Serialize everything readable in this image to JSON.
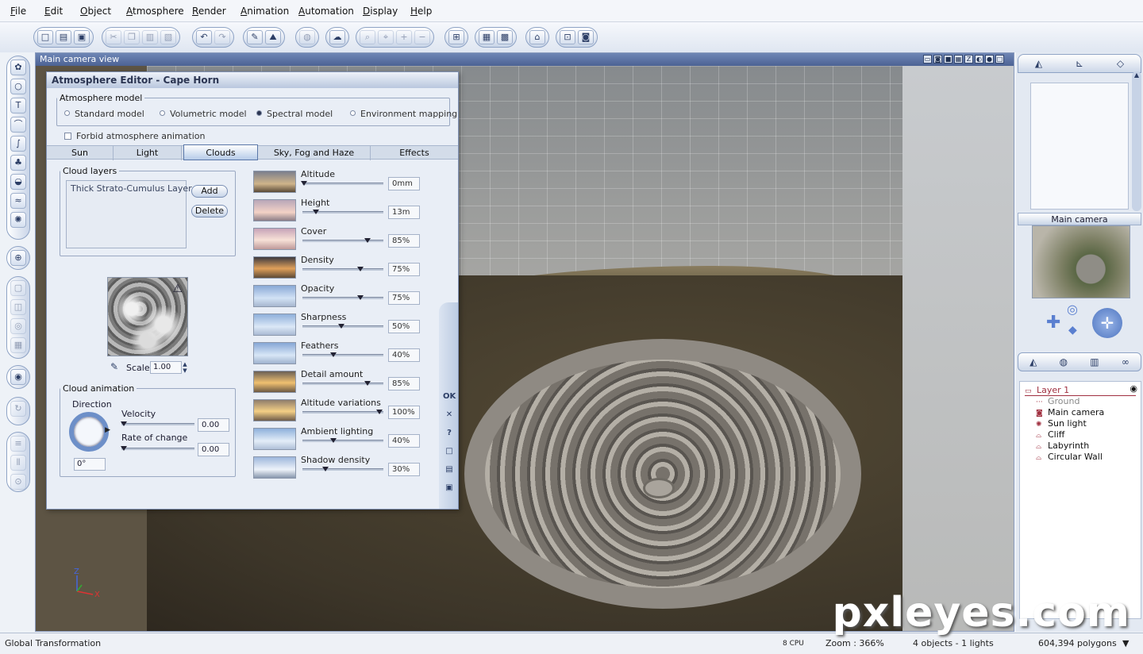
{
  "menu": [
    "File",
    "Edit",
    "Object",
    "Atmosphere",
    "Render",
    "Animation",
    "Automation",
    "Display",
    "Help"
  ],
  "viewport": {
    "title": "Main camera view"
  },
  "editor": {
    "title": "Atmosphere Editor - Cape Horn",
    "model_legend": "Atmosphere model",
    "models": [
      "Standard model",
      "Volumetric model",
      "Spectral model",
      "Environment mapping"
    ],
    "selected_model": "Spectral model",
    "forbid_label": "Forbid atmosphere animation",
    "tabs": [
      "Sun",
      "Light",
      "Clouds",
      "Sky, Fog and Haze",
      "Effects"
    ],
    "active_tab": "Clouds",
    "cloud_layers_legend": "Cloud layers",
    "layer_item": "Thick Strato-Cumulus Layer",
    "add_label": "Add",
    "delete_label": "Delete",
    "scale_label": "Scale",
    "scale_value": "1.00",
    "cloud_animation_legend": "Cloud animation",
    "direction_label": "Direction",
    "direction_value": "0°",
    "velocity_label": "Velocity",
    "velocity_value": "0.00",
    "rate_label": "Rate of change",
    "rate_value": "0.00",
    "params": [
      {
        "label": "Altitude",
        "value": "0mm",
        "level": 0.0
      },
      {
        "label": "Height",
        "value": "13m",
        "level": 0.15
      },
      {
        "label": "Cover",
        "value": "85%",
        "level": 0.82
      },
      {
        "label": "Density",
        "value": "75%",
        "level": 0.72
      },
      {
        "label": "Opacity",
        "value": "75%",
        "level": 0.72
      },
      {
        "label": "Sharpness",
        "value": "50%",
        "level": 0.48
      },
      {
        "label": "Feathers",
        "value": "40%",
        "level": 0.38
      },
      {
        "label": "Detail amount",
        "value": "85%",
        "level": 0.82
      },
      {
        "label": "Altitude variations",
        "value": "100%",
        "level": 0.97
      },
      {
        "label": "Ambient lighting",
        "value": "40%",
        "level": 0.38
      },
      {
        "label": "Shadow density",
        "value": "30%",
        "level": 0.28
      }
    ],
    "side_buttons": [
      "OK",
      "✕",
      "?"
    ]
  },
  "right_panel": {
    "camera_title": "Main camera",
    "tree": [
      {
        "label": "Layer 1",
        "indent": 0,
        "icon": "layer-icon"
      },
      {
        "label": "Ground",
        "indent": 1,
        "icon": "ground-icon"
      },
      {
        "label": "Main camera",
        "indent": 1,
        "icon": "camera-icon"
      },
      {
        "label": "Sun light",
        "indent": 1,
        "icon": "sun-icon"
      },
      {
        "label": "Cliff",
        "indent": 1,
        "icon": "terrain-icon"
      },
      {
        "label": "Labyrinth",
        "indent": 1,
        "icon": "terrain-icon"
      },
      {
        "label": "Circular Wall",
        "indent": 1,
        "icon": "terrain-icon"
      }
    ]
  },
  "status": {
    "left": "Global Transformation",
    "cpu": "8 CPU",
    "zoom": "Zoom : 366%",
    "objects": "4 objects - 1 lights",
    "polygons": "604,394 polygons"
  },
  "axis": {
    "z": "Z",
    "x": "X"
  },
  "watermark": "pxleyes.com",
  "colors": {
    "accent": "#4c6294",
    "selected_layer": "#a03040",
    "viewport_ground": "#5d5444"
  }
}
